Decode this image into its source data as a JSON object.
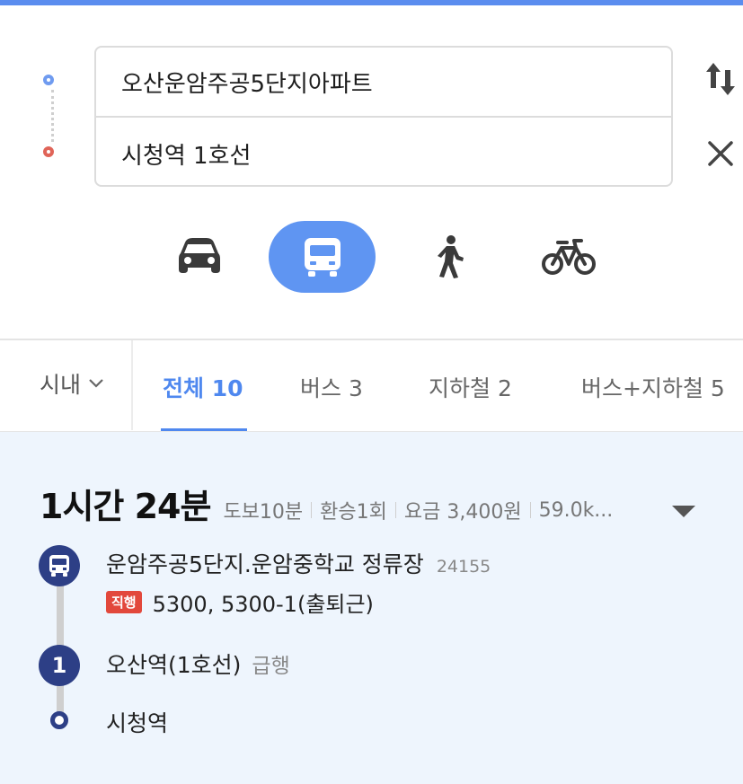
{
  "search": {
    "origin": "오산운암주공5단지아파트",
    "destination": "시청역 1호선"
  },
  "modes": [
    "car",
    "bus",
    "walk",
    "bike"
  ],
  "active_mode": "bus",
  "tabs": {
    "region": "시내",
    "items": [
      {
        "label": "전체 10"
      },
      {
        "label": "버스 3"
      },
      {
        "label": "지하철 2"
      },
      {
        "label": "버스+지하철 5"
      }
    ]
  },
  "result": {
    "duration": "1시간 24분",
    "walk": "도보10분",
    "transfer": "환승1회",
    "fare": "요금 3,400원",
    "distance": "59.0k...",
    "steps": {
      "bus_stop": "운암주공5단지.운암중학교 정류장",
      "bus_stop_id": "24155",
      "express_label": "직행",
      "bus_numbers": "5300, 5300-1(출퇴근)",
      "line_badge": "1",
      "train_station": "오산역(1호선)",
      "train_type": "급행",
      "arrival": "시청역"
    }
  },
  "colors": {
    "accent": "#5b8def",
    "route_dark": "#2d3f86",
    "origin": "#6f9bf0",
    "destination": "#e06458",
    "express": "#e2483c",
    "result_bg": "#eef5fd"
  }
}
